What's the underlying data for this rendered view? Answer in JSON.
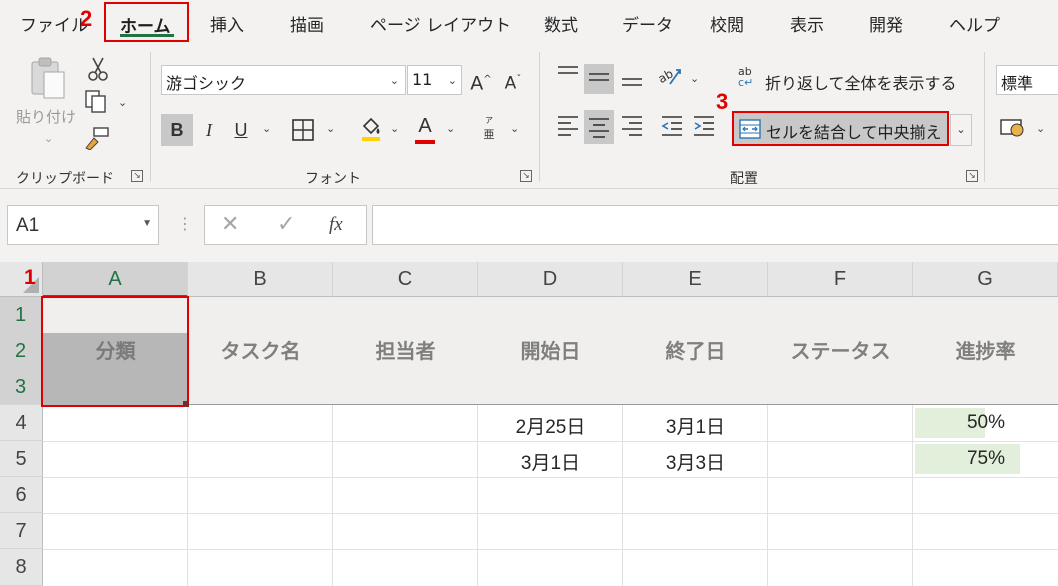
{
  "menu": {
    "tabs": [
      "ファイル",
      "ホーム",
      "挿入",
      "描画",
      "ページ レイアウト",
      "数式",
      "データ",
      "校閲",
      "表示",
      "開発",
      "ヘルプ"
    ],
    "active": "ホーム"
  },
  "steps": [
    "1",
    "2",
    "3"
  ],
  "ribbon": {
    "clipboard": {
      "paste_label": "貼り付け",
      "group_label": "クリップボード"
    },
    "font": {
      "font_name": "游ゴシック",
      "font_size": "11",
      "bold": "B",
      "italic": "I",
      "underline": "U",
      "font_color_glyph": "A",
      "phonetic_glyph": "亜",
      "group_label": "フォント"
    },
    "alignment": {
      "wrap_label": "折り返して全体を表示する",
      "merge_label": "セルを結合して中央揃え",
      "group_label": "配置"
    },
    "number": {
      "format": "標準"
    }
  },
  "formula_bar": {
    "name_box": "A1",
    "fx": "fx",
    "formula": ""
  },
  "grid": {
    "columns": [
      "A",
      "B",
      "C",
      "D",
      "E",
      "F",
      "G"
    ],
    "rows": [
      "1",
      "2",
      "3",
      "4",
      "5",
      "6",
      "7",
      "8"
    ],
    "header_labels": [
      "分類",
      "タスク名",
      "担当者",
      "開始日",
      "終了日",
      "ステータス",
      "進捗率"
    ],
    "data_rows": [
      {
        "start": "2月25日",
        "end": "3月1日",
        "progress": "50%",
        "progress_value": 0.5
      },
      {
        "start": "3月1日",
        "end": "3月3日",
        "progress": "75%",
        "progress_value": 0.75
      }
    ]
  },
  "colors": {
    "accent": "#217346",
    "highlight": "#e00000",
    "progress_fill": "#e2efda"
  }
}
